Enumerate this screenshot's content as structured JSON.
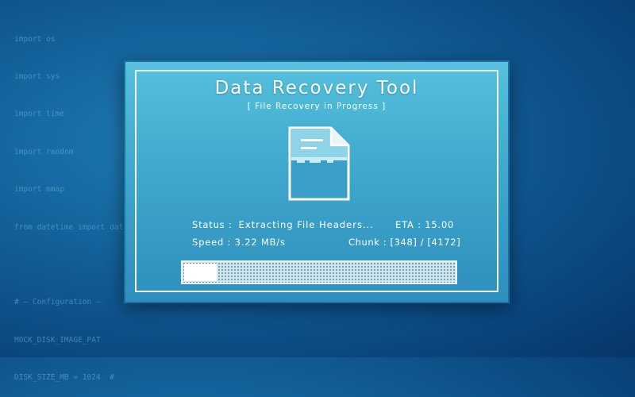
{
  "background_code": [
    "import os",
    "import sys",
    "import time",
    "import random",
    "import mmap",
    "from datetime import dat",
    "",
    "# — Configuration —",
    "MOCK_DISK_IMAGE_PAT",
    "DISK_SIZE_MB = 1024  #"
  ],
  "app": {
    "title": "Data Recovery Tool",
    "subtitle": "[ File Recovery in Progress ]"
  },
  "icon": {
    "name": "file-document-icon"
  },
  "status": {
    "label": "Status :",
    "value": "Extracting File Headers...",
    "eta": "ETA : 15.00"
  },
  "speed": {
    "text": "Speed : 3.22 MB/s"
  },
  "chunk": {
    "text": "Chunk : [348] / [4172]"
  },
  "progress": {
    "fraction": 0.12
  },
  "colors": {
    "window_top": "#56c1dd",
    "window_bottom": "#2e8fbd",
    "border": "#e9f7fc",
    "background": "#0b4a83"
  }
}
